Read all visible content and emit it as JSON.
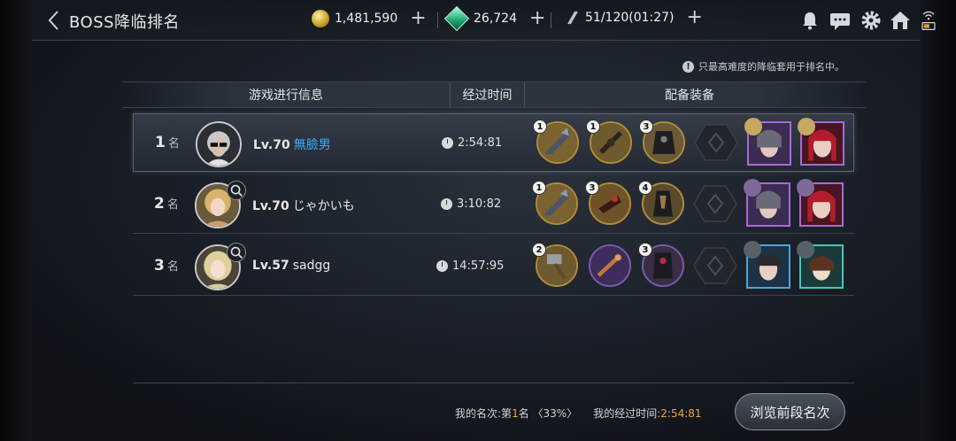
{
  "header": {
    "title": "BOSS降临排名",
    "gold": "1,481,590",
    "crystal": "26,724",
    "stamina": "51/120(01:27)",
    "icons": [
      "bell-icon",
      "chat-icon",
      "gear-icon",
      "home-icon",
      "wifi-battery-icon"
    ]
  },
  "notice": "只最高难度的降临套用于排名中。",
  "table": {
    "headers": [
      "游戏进行信息",
      "经过时间",
      "配备装备"
    ],
    "rows": [
      {
        "rank": "1",
        "rank_suffix": "名",
        "level": "Lv.70",
        "name": "無臉男",
        "time": "2:54:81",
        "badges": [
          "1",
          "1",
          "3"
        ]
      },
      {
        "rank": "2",
        "rank_suffix": "名",
        "level": "Lv.70",
        "name": "じゃかいも",
        "time": "3:10:82",
        "badges": [
          "1",
          "3",
          "4"
        ]
      },
      {
        "rank": "3",
        "rank_suffix": "名",
        "level": "Lv.57",
        "name": "sadgg",
        "time": "14:57:95",
        "badges": [
          "2",
          "",
          "3"
        ]
      }
    ]
  },
  "footer": {
    "my_rank_label": "我的名次",
    "my_rank_prefix": ":第",
    "my_rank_value": "1",
    "my_rank_suffix": "名 〈33%〉",
    "my_time_label": "我的经过时间",
    "my_time_value": ":2:54:81",
    "browse_button": "浏览前段名次"
  }
}
